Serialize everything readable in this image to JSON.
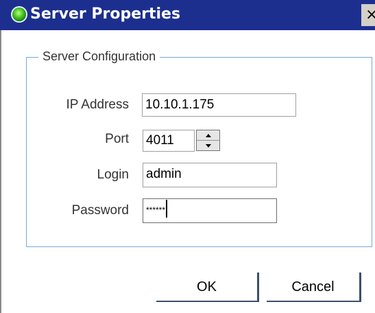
{
  "window": {
    "title": "Server Properties",
    "close_glyph": "×"
  },
  "group": {
    "legend": "Server Configuration"
  },
  "fields": {
    "ip_label": "IP Address",
    "ip_value": "10.10.1.175",
    "port_label": "Port",
    "port_value": "4011",
    "login_label": "Login",
    "login_value": "admin",
    "password_label": "Password",
    "password_value": "******"
  },
  "buttons": {
    "ok_label": "OK",
    "cancel_label": "Cancel"
  },
  "icons": {
    "title_icon": "status-green-icon",
    "spin_up": "arrow-up-icon",
    "spin_down": "arrow-down-icon"
  },
  "colors": {
    "titlebar": "#1c2f8f",
    "group_border": "#79a7d8"
  }
}
